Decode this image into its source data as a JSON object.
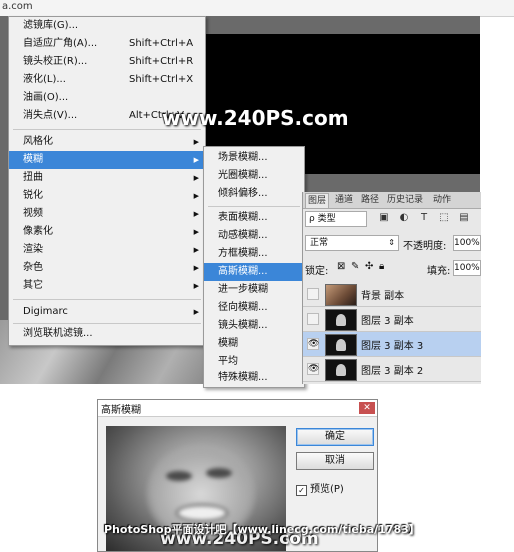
{
  "window": {
    "top_fragment": "a.com"
  },
  "filter_menu": {
    "items": [
      {
        "label": "滤镜库(G)...",
        "shortcut": ""
      },
      {
        "label": "自适应广角(A)...",
        "shortcut": "Shift+Ctrl+A"
      },
      {
        "label": "镜头校正(R)...",
        "shortcut": "Shift+Ctrl+R"
      },
      {
        "label": "液化(L)...",
        "shortcut": "Shift+Ctrl+X"
      },
      {
        "label": "油画(O)...",
        "shortcut": ""
      },
      {
        "label": "消失点(V)...",
        "shortcut": "Alt+Ctrl+V"
      }
    ],
    "groups": [
      {
        "label": "风格化"
      },
      {
        "label": "模糊"
      },
      {
        "label": "扭曲"
      },
      {
        "label": "锐化"
      },
      {
        "label": "视频"
      },
      {
        "label": "像素化"
      },
      {
        "label": "渲染"
      },
      {
        "label": "杂色"
      },
      {
        "label": "其它"
      }
    ],
    "digimarc": "Digimarc",
    "browse_online": "浏览联机滤镜..."
  },
  "blur_submenu": {
    "items": [
      {
        "label": "场景模糊..."
      },
      {
        "label": "光圈模糊..."
      },
      {
        "label": "倾斜偏移..."
      },
      {
        "label": "表面模糊..."
      },
      {
        "label": "动感模糊..."
      },
      {
        "label": "方框模糊..."
      },
      {
        "label": "高斯模糊..."
      },
      {
        "label": "进一步模糊"
      },
      {
        "label": "径向模糊..."
      },
      {
        "label": "镜头模糊..."
      },
      {
        "label": "模糊"
      },
      {
        "label": "平均"
      },
      {
        "label": "特殊模糊..."
      }
    ],
    "highlighted_index": 6
  },
  "layers_panel": {
    "tabs": [
      "图层",
      "通道",
      "路径",
      "历史记录",
      "动作"
    ],
    "filter_kind": "ρ 类型",
    "blend_mode": "正常",
    "opacity_label": "不透明度:",
    "opacity_value": "100%",
    "lock_label": "锁定:",
    "fill_label": "填充:",
    "fill_value": "100%",
    "layers": [
      {
        "name": "背景 副本",
        "visible": false,
        "selected": false
      },
      {
        "name": "图层 3 副本",
        "visible": false,
        "selected": false
      },
      {
        "name": "图层 3 副本 3",
        "visible": true,
        "selected": true
      },
      {
        "name": "图层 3 副本 2",
        "visible": true,
        "selected": false
      }
    ]
  },
  "gauss_dialog": {
    "title": "高斯模糊",
    "close": "✕",
    "ok": "确定",
    "cancel": "取消",
    "preview_label": "预览(P)",
    "preview_checked": "✓"
  },
  "watermarks": {
    "top": "www.240PS.com",
    "bottom_line1": "PhotoShop平面设计吧【www.linecg.com/tieba/1783】",
    "bottom_line2": "www.240PS.com"
  },
  "colors": {
    "highlight": "#3b86d8",
    "selected_layer": "#b8d0f0",
    "menu_bg": "#f0f0f0"
  }
}
